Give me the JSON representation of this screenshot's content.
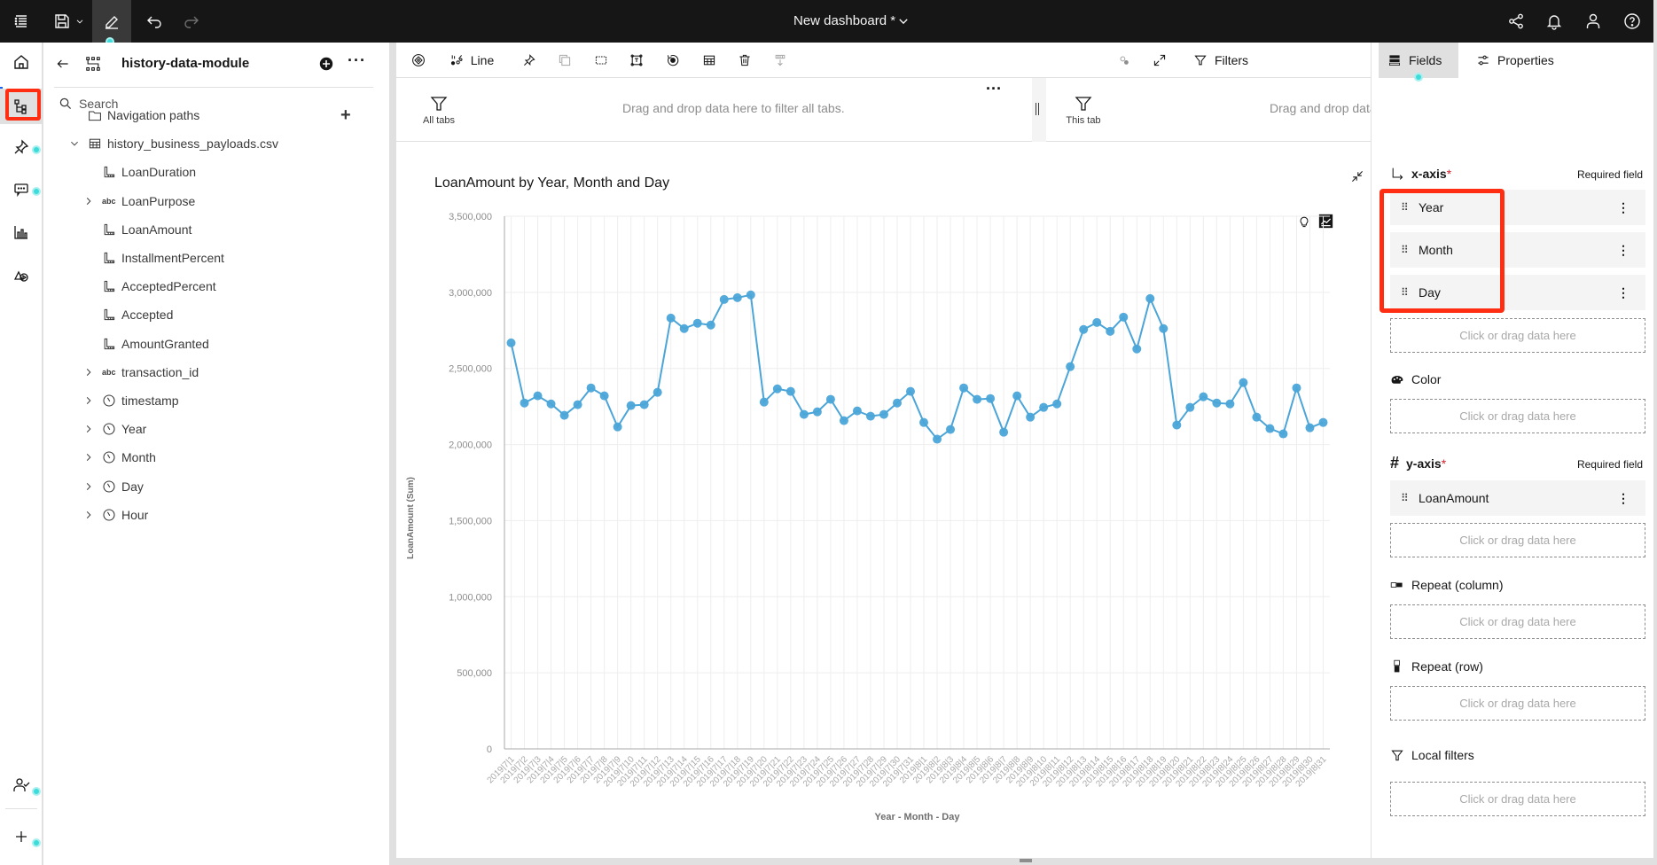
{
  "topbar": {
    "title": "New dashboard *",
    "icons": [
      "menu-icon",
      "save-icon",
      "chevron-down-icon",
      "edit-icon",
      "undo-icon",
      "redo-icon",
      "share-icon",
      "notification-icon",
      "user-icon",
      "help-icon"
    ]
  },
  "left_rail": {
    "items": [
      "home",
      "data-sources",
      "pin",
      "comments",
      "visualizations",
      "explore",
      "user-check",
      "add"
    ]
  },
  "data_panel": {
    "title": "history-data-module",
    "search_placeholder": "Search",
    "items": [
      {
        "label": "Navigation paths",
        "icon": "folder",
        "level": 0,
        "expandable": false
      },
      {
        "label": "history_business_payloads.csv",
        "icon": "table",
        "level": 0,
        "expandable": true,
        "expanded": true
      },
      {
        "label": "LoanDuration",
        "icon": "measure",
        "level": 1,
        "expandable": false
      },
      {
        "label": "LoanPurpose",
        "icon": "abc",
        "level": 1,
        "expandable": true
      },
      {
        "label": "LoanAmount",
        "icon": "measure",
        "level": 1,
        "expandable": false
      },
      {
        "label": "InstallmentPercent",
        "icon": "measure",
        "level": 1,
        "expandable": false
      },
      {
        "label": "AcceptedPercent",
        "icon": "measure",
        "level": 1,
        "expandable": false
      },
      {
        "label": "Accepted",
        "icon": "measure",
        "level": 1,
        "expandable": false
      },
      {
        "label": "AmountGranted",
        "icon": "measure",
        "level": 1,
        "expandable": false
      },
      {
        "label": "transaction_id",
        "icon": "abc",
        "level": 1,
        "expandable": true
      },
      {
        "label": "timestamp",
        "icon": "time",
        "level": 1,
        "expandable": true
      },
      {
        "label": "Year",
        "icon": "time",
        "level": 1,
        "expandable": true
      },
      {
        "label": "Month",
        "icon": "time",
        "level": 1,
        "expandable": true
      },
      {
        "label": "Day",
        "icon": "time",
        "level": 1,
        "expandable": true
      },
      {
        "label": "Hour",
        "icon": "time",
        "level": 1,
        "expandable": true
      }
    ]
  },
  "toolbar": {
    "viz_type": "Line",
    "filters": "Filters",
    "fields": "Fields",
    "properties": "Properties"
  },
  "filter_bar": {
    "all_tabs_label": "All tabs",
    "all_tabs_hint": "Drag and drop data here to filter all tabs.",
    "this_tab_label": "This tab",
    "this_tab_hint": "Drag and drop data here to filter this tab."
  },
  "fields_panel": {
    "x_axis": {
      "label": "x-axis",
      "required": "Required field",
      "fields": [
        "Year",
        "Month",
        "Day"
      ]
    },
    "color": {
      "label": "Color"
    },
    "y_axis": {
      "label": "y-axis",
      "required": "Required field",
      "fields": [
        "LoanAmount"
      ]
    },
    "repeat_column": {
      "label": "Repeat (column)"
    },
    "repeat_row": {
      "label": "Repeat (row)"
    },
    "local_filters": {
      "label": "Local filters"
    },
    "drop_hint": "Click or drag data here"
  },
  "chart_data": {
    "type": "line",
    "title": "LoanAmount by Year, Month and Day",
    "xlabel": "Year - Month - Day",
    "ylabel": "LoanAmount (Sum)",
    "ylim": [
      0,
      3500000
    ],
    "yticks": [
      0,
      500000,
      1000000,
      1500000,
      2000000,
      2500000,
      3000000,
      3500000
    ],
    "ytick_labels": [
      "0",
      "500,000",
      "1,000,000",
      "1,500,000",
      "2,000,000",
      "2,500,000",
      "3,000,000",
      "3,500,000"
    ],
    "grid": true,
    "color": "#4ba5d8",
    "categories": [
      "2019|7|1",
      "2019|7|2",
      "2019|7|3",
      "2019|7|4",
      "2019|7|5",
      "2019|7|6",
      "2019|7|7",
      "2019|7|8",
      "2019|7|9",
      "2019|7|10",
      "2019|7|11",
      "2019|7|12",
      "2019|7|13",
      "2019|7|14",
      "2019|7|15",
      "2019|7|16",
      "2019|7|17",
      "2019|7|18",
      "2019|7|19",
      "2019|7|20",
      "2019|7|21",
      "2019|7|22",
      "2019|7|23",
      "2019|7|24",
      "2019|7|25",
      "2019|7|26",
      "2019|7|27",
      "2019|7|28",
      "2019|7|29",
      "2019|7|30",
      "2019|7|31",
      "2019|8|1",
      "2019|8|2",
      "2019|8|3",
      "2019|8|4",
      "2019|8|5",
      "2019|8|6",
      "2019|8|7",
      "2019|8|8",
      "2019|8|9",
      "2019|8|10",
      "2019|8|11",
      "2019|8|12",
      "2019|8|13",
      "2019|8|14",
      "2019|8|15",
      "2019|8|16",
      "2019|8|17",
      "2019|8|18",
      "2019|8|19",
      "2019|8|20",
      "2019|8|21",
      "2019|8|22",
      "2019|8|23",
      "2019|8|24",
      "2019|8|25",
      "2019|8|26",
      "2019|8|27",
      "2019|8|28",
      "2019|8|29",
      "2019|8|30",
      "2019|8|31"
    ],
    "values": [
      2668000,
      2273000,
      2320000,
      2267000,
      2192000,
      2262000,
      2372000,
      2320000,
      2116000,
      2256000,
      2262000,
      2343000,
      2831000,
      2762000,
      2797000,
      2785000,
      2953000,
      2965000,
      2983000,
      2279000,
      2366000,
      2349000,
      2198000,
      2215000,
      2297000,
      2157000,
      2221000,
      2186000,
      2198000,
      2273000,
      2349000,
      2145000,
      2035000,
      2099000,
      2372000,
      2297000,
      2302000,
      2081000,
      2320000,
      2180000,
      2244000,
      2267000,
      2512000,
      2756000,
      2802000,
      2744000,
      2837000,
      2628000,
      2959000,
      2762000,
      2128000,
      2244000,
      2314000,
      2273000,
      2267000,
      2407000,
      2180000,
      2105000,
      2070000,
      2372000,
      2110000,
      2145000
    ]
  }
}
